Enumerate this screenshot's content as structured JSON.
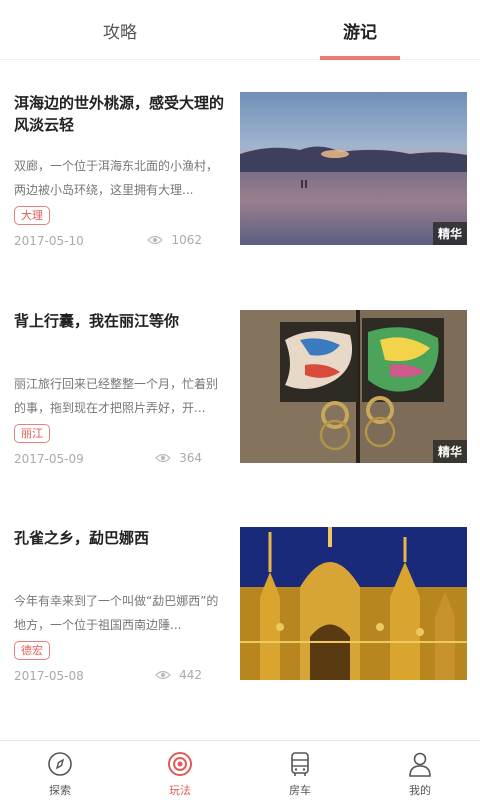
{
  "tabs": [
    {
      "label": "攻略"
    },
    {
      "label": "游记"
    }
  ],
  "articles": [
    {
      "title": "洱海边的世外桃源，感受大理的风淡云轻",
      "desc": "双廊，一个位于洱海东北面的小渔村，两边被小岛环绕，这里拥有大理...",
      "tag": "大理",
      "date": "2017-05-10",
      "views": "1062",
      "badge": "精华"
    },
    {
      "title": "背上行囊，我在丽江等你",
      "desc": "丽江旅行回来已经整整一个月，忙着别的事，拖到现在才把照片弄好，开...",
      "tag": "丽江",
      "date": "2017-05-09",
      "views": "364",
      "badge": "精华"
    },
    {
      "title": "孔雀之乡，勐巴娜西",
      "desc": "今年有幸来到了一个叫做“勐巴娜西”的地方，一个位于祖国西南边陲...",
      "tag": "德宏",
      "date": "2017-05-08",
      "views": "442"
    }
  ],
  "bottom_nav": [
    {
      "label": "探索",
      "icon": "compass-icon"
    },
    {
      "label": "玩法",
      "icon": "target-icon"
    },
    {
      "label": "房车",
      "icon": "bus-icon"
    },
    {
      "label": "我的",
      "icon": "user-icon"
    }
  ],
  "colors": {
    "accent": "#e35b59",
    "indicator": "#ef7776"
  }
}
